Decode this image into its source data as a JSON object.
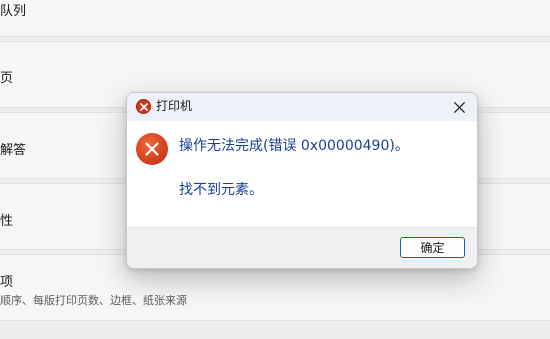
{
  "background": {
    "rows": [
      {
        "title": "队列",
        "subtitle": ""
      },
      {
        "title": "页",
        "subtitle": ""
      },
      {
        "title": "解答",
        "subtitle": ""
      },
      {
        "title": "性",
        "subtitle": ""
      },
      {
        "title": "项",
        "subtitle": "顺序、每版打印页数、边框、纸张来源"
      }
    ]
  },
  "dialog": {
    "title": "打印机",
    "message": "操作无法完成(错误 0x00000490)。",
    "detail": "找不到元素。",
    "ok_label": "确定",
    "icon": "error-icon",
    "close_icon": "close-icon"
  },
  "colors": {
    "accent": "#0a64c8",
    "error": "#d5431f",
    "message_text": "#1a3f94"
  }
}
